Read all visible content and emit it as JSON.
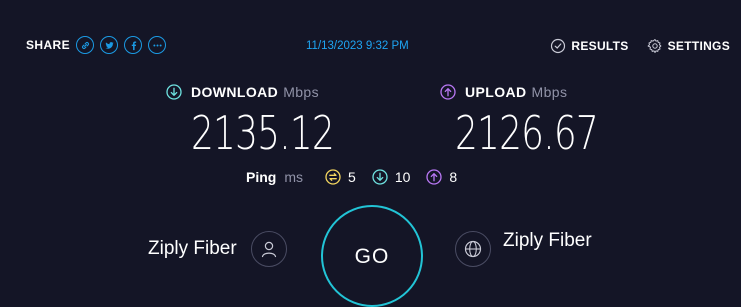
{
  "topbar": {
    "share_label": "SHARE",
    "share_buttons": [
      "link-icon",
      "twitter-icon",
      "facebook-icon",
      "more-icon"
    ],
    "datetime": "11/13/2023 9:32 PM",
    "results_label": "RESULTS",
    "settings_label": "SETTINGS"
  },
  "download": {
    "label": "DOWNLOAD",
    "unit": "Mbps",
    "value": "2135.12",
    "icon": "download-arrow-icon",
    "color": "#6fe3e1"
  },
  "upload": {
    "label": "UPLOAD",
    "unit": "Mbps",
    "value": "2126.67",
    "icon": "upload-arrow-icon",
    "color": "#b978f5"
  },
  "ping": {
    "label": "Ping",
    "unit": "ms",
    "idle": "5",
    "download": "10",
    "upload": "8"
  },
  "isp": {
    "name": "Ziply Fiber",
    "icon": "user-icon"
  },
  "server": {
    "name": "Ziply Fiber",
    "icon": "globe-icon"
  },
  "go_button": {
    "label": "GO",
    "color": "#22c4d6"
  },
  "colors": {
    "background": "#141526",
    "accent": "#1ea4f2",
    "ping_idle": "#f6d860"
  }
}
